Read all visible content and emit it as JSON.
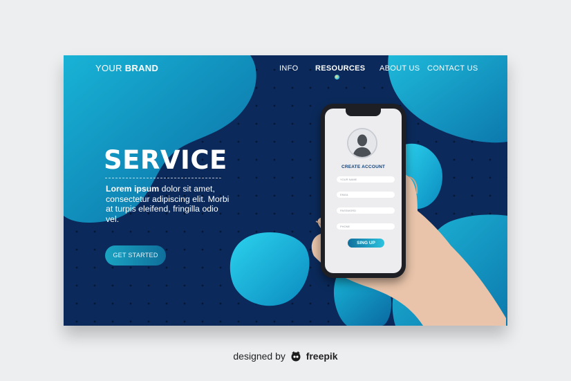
{
  "nav": {
    "brand_light": "YOUR",
    "brand_bold": "BRAND",
    "items": [
      "INFO",
      "RESOURCES",
      "ABOUT US",
      "CONTACT US"
    ],
    "active": "RESOURCES"
  },
  "hero": {
    "title": "SERVICE",
    "desc_bold": "Lorem ipsum",
    "desc_rest": "dolor sit amet, consectetur adipiscing elit. Morbi at turpis eleifend, fringilla odio vel.",
    "cta_label": "GET STARTED"
  },
  "phone": {
    "screen_title": "CREATE ACCOUNT",
    "fields": [
      "YOUR NAME",
      "EMAIL",
      "PASSWORD",
      "PHONE"
    ],
    "signup_label": "SING UP"
  },
  "credit": {
    "prefix": "designed by",
    "brand": "freepik"
  },
  "colors": {
    "page_bg": "#eceef0",
    "card_bg": "#0b2a5b",
    "accent": "#2cc3df"
  },
  "icons": [
    "user-avatar-icon",
    "freepik-logo-icon"
  ]
}
